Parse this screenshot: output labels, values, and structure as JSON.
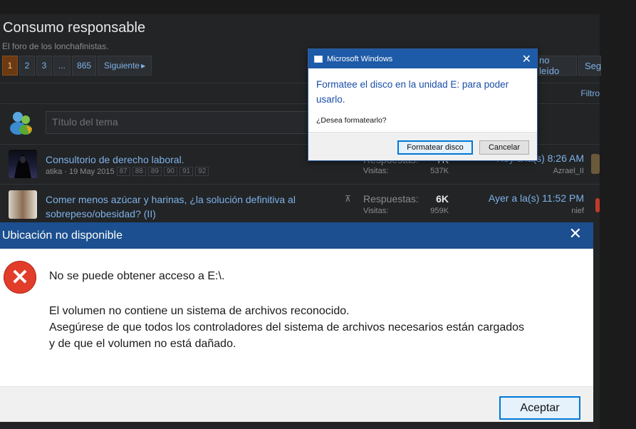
{
  "forum": {
    "title": "Consumo responsable",
    "description": "El foro de los lonchafinistas.",
    "pager": [
      "1",
      "2",
      "3",
      "...",
      "865"
    ],
    "next_label": "Siguiente",
    "unread_label": "no leído",
    "seg_label": "Seg",
    "filter_label": "Filtro",
    "new_topic_placeholder": "Título del tema"
  },
  "threads": [
    {
      "title": "Consultorio de derecho laboral.",
      "meta": "atika · 19 May 2015",
      "pages": [
        "87",
        "88",
        "89",
        "90",
        "91",
        "92"
      ],
      "replies_label": "Respuestas:",
      "replies": "7K",
      "views_label": "Visitas:",
      "views": "537K",
      "last_date": "Hoy a la(s) 8:26 AM",
      "last_user": "Azrael_II"
    },
    {
      "title_line1": "Comer menos azúcar y harinas, ¿la solución definitiva al",
      "title_line2": "sobrepeso/obesidad? (II)",
      "replies_label": "Respuestas:",
      "replies": "6K",
      "views_label": "Visitas:",
      "views": "959K",
      "last_date": "Ayer a la(s) 11:52 PM",
      "last_user": "nief"
    }
  ],
  "ms_dialog": {
    "title": "Microsoft Windows",
    "message": "Formatee el disco en la unidad E: para poder usarlo.",
    "question": "¿Desea formatearlo?",
    "format_button": "Formatear disco",
    "cancel_button": "Cancelar",
    "close_glyph": "✕"
  },
  "location_dialog": {
    "title": "Ubicación no disponible",
    "line1": "No se puede obtener acceso a E:\\.",
    "line2": "El volumen no contiene un sistema de archivos reconocido.",
    "line3": "Asegúrese de que todos los controladores del sistema de archivos necesarios están cargados",
    "line4": "y de que el volumen no está dañado.",
    "accept_button": "Aceptar",
    "close_glyph": "✕"
  },
  "colors": {
    "accent_blue": "#1b4f8f",
    "error_red": "#e23c2a",
    "link": "#7fb2e8"
  }
}
